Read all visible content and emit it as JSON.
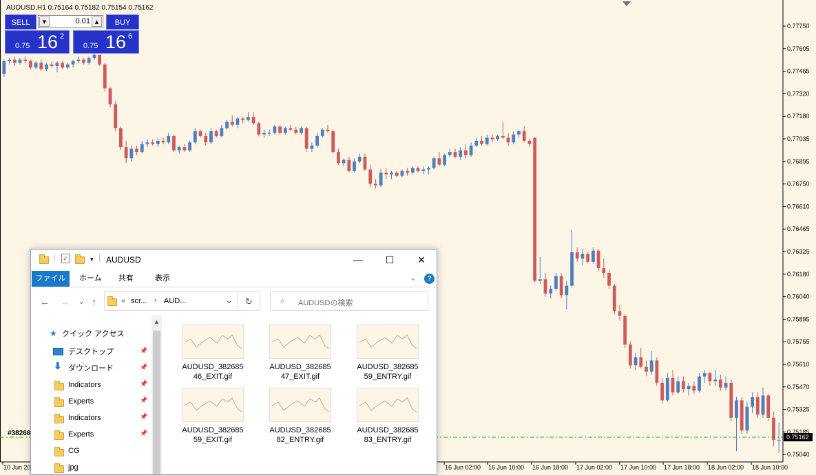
{
  "chart": {
    "symbol_line": "AUDUSD,H1  0.75164 0.75182 0.75154 0.75162",
    "colors": {
      "background": "#fdf5e6",
      "bull": "#4a80c0",
      "bear": "#d05a5a",
      "order_line": "#11b811"
    },
    "trade_panel": {
      "sell_label": "SELL",
      "buy_label": "BUY",
      "lot_value": "0.01",
      "sell_price_prefix": "0.75",
      "sell_price_main": "16",
      "sell_price_sup": "2",
      "buy_price_prefix": "0.75",
      "buy_price_main": "16",
      "buy_price_sup": "6"
    },
    "price_scale": [
      "0.77750",
      "0.77605",
      "0.77465",
      "0.77320",
      "0.77180",
      "0.77035",
      "0.76895",
      "0.76750",
      "0.76610",
      "0.76465",
      "0.76325",
      "0.76180",
      "0.76040",
      "0.75895",
      "0.75755",
      "0.75610",
      "0.75470",
      "0.75325",
      "0.75185",
      "0.75040"
    ],
    "current_price": "0.75162",
    "order_label": "#38268",
    "time_axis": [
      "10 Jun 20",
      "16 Jun 02:00",
      "16 Jun 10:00",
      "16 Jun 18:00",
      "17 Jun 02:00",
      "17 Jun 10:00",
      "17 Jun 18:00",
      "18 Jun 02:00",
      "18 Jun 10:00"
    ]
  },
  "chart_data": {
    "type": "candlestick",
    "y_range": [
      0.7504,
      0.7789
    ],
    "candles": [
      [
        0.7746,
        0.7755,
        0.7744,
        0.7754
      ],
      [
        0.7754,
        0.7756,
        0.7752,
        0.7755
      ],
      [
        0.7755,
        0.7757,
        0.7751,
        0.7753
      ],
      [
        0.7753,
        0.7756,
        0.7752,
        0.7755
      ],
      [
        0.7755,
        0.7757,
        0.7752,
        0.7754
      ],
      [
        0.7754,
        0.7755,
        0.7749,
        0.775
      ],
      [
        0.775,
        0.7754,
        0.7749,
        0.7753
      ],
      [
        0.7753,
        0.7755,
        0.7748,
        0.7749
      ],
      [
        0.7749,
        0.7753,
        0.7748,
        0.7752
      ],
      [
        0.7752,
        0.7754,
        0.775,
        0.7751
      ],
      [
        0.7751,
        0.7754,
        0.7747,
        0.7753
      ],
      [
        0.7753,
        0.7754,
        0.7749,
        0.775
      ],
      [
        0.775,
        0.7753,
        0.7749,
        0.7752
      ],
      [
        0.7752,
        0.7755,
        0.775,
        0.7754
      ],
      [
        0.7754,
        0.7757,
        0.7753,
        0.7755
      ],
      [
        0.7755,
        0.7756,
        0.7752,
        0.7753
      ],
      [
        0.7753,
        0.7757,
        0.7752,
        0.7756
      ],
      [
        0.7756,
        0.7759,
        0.7755,
        0.7758
      ],
      [
        0.7758,
        0.7758,
        0.7751,
        0.7752
      ],
      [
        0.7752,
        0.7753,
        0.7735,
        0.7737
      ],
      [
        0.7737,
        0.7738,
        0.7725,
        0.7727
      ],
      [
        0.7727,
        0.7729,
        0.771,
        0.7712
      ],
      [
        0.7712,
        0.7713,
        0.7698,
        0.77
      ],
      [
        0.77,
        0.7704,
        0.769,
        0.7693
      ],
      [
        0.7693,
        0.7701,
        0.7691,
        0.7699
      ],
      [
        0.7699,
        0.7701,
        0.7695,
        0.7697
      ],
      [
        0.7697,
        0.7704,
        0.7696,
        0.7702
      ],
      [
        0.7702,
        0.7705,
        0.77,
        0.7703
      ],
      [
        0.7703,
        0.7705,
        0.7701,
        0.7702
      ],
      [
        0.7702,
        0.7706,
        0.77,
        0.7704
      ],
      [
        0.7704,
        0.7706,
        0.7702,
        0.7703
      ],
      [
        0.7703,
        0.7709,
        0.7702,
        0.7707
      ],
      [
        0.7707,
        0.7708,
        0.7697,
        0.7698
      ],
      [
        0.7698,
        0.7701,
        0.7696,
        0.77
      ],
      [
        0.77,
        0.7702,
        0.7697,
        0.7698
      ],
      [
        0.7698,
        0.7704,
        0.7697,
        0.7703
      ],
      [
        0.7703,
        0.7712,
        0.7702,
        0.771
      ],
      [
        0.771,
        0.7711,
        0.7706,
        0.7707
      ],
      [
        0.7707,
        0.7709,
        0.7701,
        0.7703
      ],
      [
        0.7703,
        0.7712,
        0.7702,
        0.771
      ],
      [
        0.771,
        0.7711,
        0.7706,
        0.7707
      ],
      [
        0.7707,
        0.7714,
        0.7706,
        0.7712
      ],
      [
        0.7712,
        0.7717,
        0.7711,
        0.7716
      ],
      [
        0.7716,
        0.772,
        0.7713,
        0.7714
      ],
      [
        0.7714,
        0.7719,
        0.7712,
        0.7718
      ],
      [
        0.7718,
        0.7719,
        0.7715,
        0.7717
      ],
      [
        0.7717,
        0.7722,
        0.7716,
        0.7719
      ],
      [
        0.7719,
        0.7722,
        0.7714,
        0.7715
      ],
      [
        0.7715,
        0.7716,
        0.7707,
        0.7708
      ],
      [
        0.7708,
        0.7711,
        0.7706,
        0.7709
      ],
      [
        0.7709,
        0.7711,
        0.7707,
        0.7709
      ],
      [
        0.7709,
        0.7714,
        0.7708,
        0.7713
      ],
      [
        0.7713,
        0.7714,
        0.7708,
        0.7709
      ],
      [
        0.7709,
        0.7713,
        0.7708,
        0.7712
      ],
      [
        0.7712,
        0.7714,
        0.771,
        0.7711
      ],
      [
        0.7711,
        0.7713,
        0.7708,
        0.7709
      ],
      [
        0.7709,
        0.7713,
        0.7708,
        0.7712
      ],
      [
        0.7712,
        0.7713,
        0.7697,
        0.7699
      ],
      [
        0.7699,
        0.7703,
        0.7697,
        0.7701
      ],
      [
        0.7701,
        0.7709,
        0.77,
        0.7707
      ],
      [
        0.7707,
        0.7712,
        0.7706,
        0.7711
      ],
      [
        0.7711,
        0.7714,
        0.7709,
        0.771
      ],
      [
        0.771,
        0.7711,
        0.7696,
        0.7697
      ],
      [
        0.7697,
        0.7699,
        0.7689,
        0.769
      ],
      [
        0.769,
        0.7693,
        0.7688,
        0.7692
      ],
      [
        0.7692,
        0.7694,
        0.7684,
        0.7685
      ],
      [
        0.7685,
        0.7693,
        0.7684,
        0.7691
      ],
      [
        0.7691,
        0.7696,
        0.769,
        0.7694
      ],
      [
        0.7694,
        0.7696,
        0.7685,
        0.7686
      ],
      [
        0.7686,
        0.7689,
        0.7675,
        0.7677
      ],
      [
        0.7677,
        0.768,
        0.7674,
        0.7676
      ],
      [
        0.7676,
        0.7686,
        0.7675,
        0.7684
      ],
      [
        0.7684,
        0.7687,
        0.768,
        0.7683
      ],
      [
        0.7683,
        0.7685,
        0.768,
        0.7684
      ],
      [
        0.7684,
        0.7685,
        0.7681,
        0.7682
      ],
      [
        0.7682,
        0.7686,
        0.7681,
        0.7685
      ],
      [
        0.7685,
        0.7687,
        0.7682,
        0.7684
      ],
      [
        0.7684,
        0.7688,
        0.7683,
        0.7687
      ],
      [
        0.7687,
        0.7688,
        0.7684,
        0.7685
      ],
      [
        0.7685,
        0.7688,
        0.7683,
        0.7686
      ],
      [
        0.7686,
        0.7688,
        0.7683,
        0.7687
      ],
      [
        0.7687,
        0.7694,
        0.7686,
        0.7693
      ],
      [
        0.7693,
        0.7697,
        0.7688,
        0.7689
      ],
      [
        0.7689,
        0.7696,
        0.7688,
        0.7695
      ],
      [
        0.7695,
        0.7699,
        0.7694,
        0.7697
      ],
      [
        0.7697,
        0.7699,
        0.7693,
        0.7694
      ],
      [
        0.7694,
        0.77,
        0.7692,
        0.7698
      ],
      [
        0.7698,
        0.7702,
        0.7693,
        0.7695
      ],
      [
        0.7695,
        0.7703,
        0.7694,
        0.7701
      ],
      [
        0.7701,
        0.7706,
        0.77,
        0.7704
      ],
      [
        0.7704,
        0.7707,
        0.7701,
        0.7702
      ],
      [
        0.7702,
        0.7708,
        0.7701,
        0.7706
      ],
      [
        0.7706,
        0.7708,
        0.7703,
        0.7705
      ],
      [
        0.7705,
        0.7708,
        0.7704,
        0.7707
      ],
      [
        0.7707,
        0.7716,
        0.7705,
        0.7706
      ],
      [
        0.7706,
        0.7709,
        0.7701,
        0.7703
      ],
      [
        0.7703,
        0.771,
        0.7702,
        0.7708
      ],
      [
        0.7708,
        0.7711,
        0.7706,
        0.771
      ],
      [
        0.771,
        0.7713,
        0.7703,
        0.7704
      ],
      [
        0.7704,
        0.7705,
        0.77,
        0.7702
      ],
      [
        0.7706,
        0.7706,
        0.7615,
        0.7616
      ],
      [
        0.7616,
        0.7631,
        0.7614,
        0.7617
      ],
      [
        0.7617,
        0.7621,
        0.7606,
        0.7608
      ],
      [
        0.7608,
        0.7613,
        0.7605,
        0.7611
      ],
      [
        0.7611,
        0.7621,
        0.761,
        0.7619
      ],
      [
        0.7619,
        0.7621,
        0.7605,
        0.7607
      ],
      [
        0.7607,
        0.7616,
        0.7598,
        0.7613
      ],
      [
        0.7613,
        0.7648,
        0.7612,
        0.7634
      ],
      [
        0.7634,
        0.7637,
        0.7628,
        0.763
      ],
      [
        0.763,
        0.7636,
        0.7626,
        0.7633
      ],
      [
        0.7633,
        0.7634,
        0.7627,
        0.7628
      ],
      [
        0.7628,
        0.7637,
        0.7627,
        0.7635
      ],
      [
        0.7635,
        0.7636,
        0.7622,
        0.7624
      ],
      [
        0.7624,
        0.763,
        0.7618,
        0.7621
      ],
      [
        0.7621,
        0.7623,
        0.7611,
        0.7613
      ],
      [
        0.7613,
        0.7614,
        0.7595,
        0.7597
      ],
      [
        0.7597,
        0.7601,
        0.7591,
        0.7594
      ],
      [
        0.7594,
        0.7595,
        0.7574,
        0.7576
      ],
      [
        0.7576,
        0.7578,
        0.7561,
        0.7563
      ],
      [
        0.7563,
        0.7571,
        0.756,
        0.7568
      ],
      [
        0.7568,
        0.7574,
        0.7561,
        0.7562
      ],
      [
        0.7562,
        0.7566,
        0.7556,
        0.7559
      ],
      [
        0.7559,
        0.7572,
        0.7557,
        0.7566
      ],
      [
        0.7566,
        0.7568,
        0.755,
        0.7552
      ],
      [
        0.7552,
        0.7555,
        0.7539,
        0.7541
      ],
      [
        0.7541,
        0.7558,
        0.754,
        0.7555
      ],
      [
        0.7555,
        0.756,
        0.7544,
        0.7546
      ],
      [
        0.7546,
        0.7556,
        0.7545,
        0.7553
      ],
      [
        0.7553,
        0.7556,
        0.7546,
        0.7548
      ],
      [
        0.7548,
        0.7552,
        0.7544,
        0.755
      ],
      [
        0.755,
        0.7553,
        0.7545,
        0.7547
      ],
      [
        0.7547,
        0.7558,
        0.7546,
        0.7556
      ],
      [
        0.7556,
        0.756,
        0.7552,
        0.7558
      ],
      [
        0.7558,
        0.7559,
        0.755,
        0.7553
      ],
      [
        0.7553,
        0.756,
        0.755,
        0.7554
      ],
      [
        0.7554,
        0.7557,
        0.7547,
        0.7549
      ],
      [
        0.7549,
        0.7556,
        0.7547,
        0.7552
      ],
      [
        0.7552,
        0.7554,
        0.7528,
        0.753
      ],
      [
        0.753,
        0.7543,
        0.7509,
        0.7541
      ],
      [
        0.7541,
        0.7543,
        0.752,
        0.7522
      ],
      [
        0.7522,
        0.754,
        0.752,
        0.7537
      ],
      [
        0.7537,
        0.7546,
        0.7533,
        0.7543
      ],
      [
        0.7543,
        0.7546,
        0.753,
        0.7532
      ],
      [
        0.7532,
        0.7549,
        0.753,
        0.7544
      ],
      [
        0.7544,
        0.7545,
        0.7528,
        0.753
      ],
      [
        0.753,
        0.7534,
        0.7512,
        0.7516
      ],
      [
        0.7516,
        0.7527,
        0.7508,
        0.7516
      ]
    ]
  },
  "explorer": {
    "title": "AUDUSD",
    "ribbon_tabs": [
      "ファイル",
      "ホーム",
      "共有",
      "表示"
    ],
    "address_parts": [
      "«",
      "scr...",
      "›",
      "AUD..."
    ],
    "search_placeholder": "AUDUSDの検索",
    "quick_access": "クイック アクセス",
    "nav_items": [
      "デスクトップ",
      "ダウンロード",
      "Indicators",
      "Experts",
      "Indicators",
      "Experts",
      "CG",
      "jpg"
    ],
    "files": [
      {
        "line1": "AUDUSD_382685",
        "line2": "46_EXIT.gif"
      },
      {
        "line1": "AUDUSD_382685",
        "line2": "47_EXIT.gif"
      },
      {
        "line1": "AUDUSD_382685",
        "line2": "59_ENTRY.gif"
      },
      {
        "line1": "AUDUSD_382685",
        "line2": "59_EXIT.gif"
      },
      {
        "line1": "AUDUSD_382685",
        "line2": "82_ENTRY.gif"
      },
      {
        "line1": "AUDUSD_382685",
        "line2": "83_ENTRY.gif"
      }
    ]
  }
}
